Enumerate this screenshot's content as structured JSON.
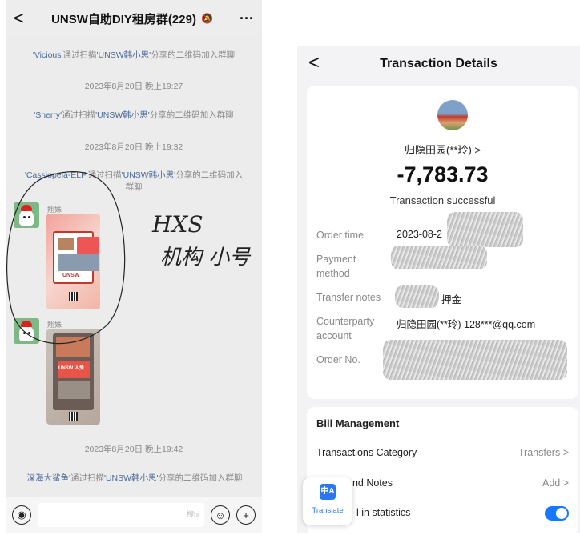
{
  "chat": {
    "title": "UNSW自助DIY租房群(229)",
    "back": "<",
    "more": "···",
    "mute_icon": "bell-off-icon",
    "messages": [
      {
        "type": "system",
        "name": "'Vicious'",
        "text": "通过扫描",
        "by": "'UNSW韩小思'",
        "tail": "分享的二维码加入群聊"
      },
      {
        "type": "time",
        "text": "2023年8月20日 晚上19:27"
      },
      {
        "type": "system",
        "name": "'Sherry'",
        "text": "通过扫描",
        "by": "'UNSW韩小思'",
        "tail": "分享的二维码加入群聊"
      },
      {
        "type": "time",
        "text": "2023年8月20日 晚上19:32"
      },
      {
        "type": "system",
        "name": "'Cassiopeia-ELF'",
        "text": "通过扫描",
        "by": "'UNSW韩小思'",
        "tail": "分享的二维码加入群聊"
      },
      {
        "type": "time",
        "text": "2023年8月20日 晚上19:42"
      },
      {
        "type": "system",
        "name": "'深海大鲨鱼'",
        "text": "通过扫描",
        "by": "'UNSW韩小思'",
        "tail": "分享的二维码加入群聊"
      }
    ],
    "image_messages": [
      {
        "sender": "翔姝",
        "poster_text": "UNSW"
      },
      {
        "sender": "翔姝",
        "poster_text": "UNSW 人免"
      }
    ],
    "handwriting": {
      "line1": "HXS",
      "line2": "机构 小号"
    },
    "watermark": "搜hi"
  },
  "transaction": {
    "title": "Transaction Details",
    "back": "<",
    "payee": "归隐田园(**玲) >",
    "amount": "-7,783.73",
    "status": "Transaction successful",
    "fields": [
      {
        "label": "Order time",
        "value": "2023-08-2"
      },
      {
        "label": "Payment method",
        "value": ""
      },
      {
        "label": "Transfer notes",
        "value": "押金"
      },
      {
        "label": "Counterparty account",
        "value": "归隐田园(**玲) 128***@qq.com"
      },
      {
        "label": "Order No.",
        "value": ""
      }
    ],
    "bill": {
      "title": "Bill Management",
      "category_label": "Transactions Category",
      "category_value": "Transfers >",
      "notes_label": "and Notes",
      "notes_value": "Add >",
      "stats_label": "l in statistics",
      "stats_on": true
    },
    "translate": {
      "label": "Translate",
      "icon": "translate-icon"
    }
  },
  "colors": {
    "accent": "#1677ff",
    "chat_bg": "#ececec",
    "link": "#4a6a99"
  }
}
